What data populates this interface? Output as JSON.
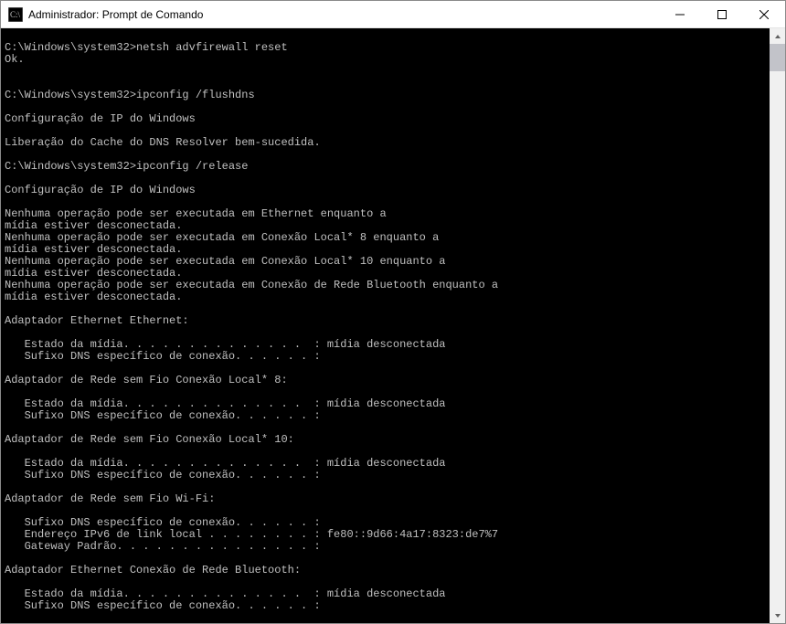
{
  "window": {
    "title": "Administrador: Prompt de Comando"
  },
  "terminal": {
    "lines": [
      "",
      "C:\\Windows\\system32>netsh advfirewall reset",
      "Ok.",
      "",
      "",
      "C:\\Windows\\system32>ipconfig /flushdns",
      "",
      "Configuração de IP do Windows",
      "",
      "Liberação do Cache do DNS Resolver bem-sucedida.",
      "",
      "C:\\Windows\\system32>ipconfig /release",
      "",
      "Configuração de IP do Windows",
      "",
      "Nenhuma operação pode ser executada em Ethernet enquanto a",
      "mídia estiver desconectada.",
      "Nenhuma operação pode ser executada em Conexão Local* 8 enquanto a",
      "mídia estiver desconectada.",
      "Nenhuma operação pode ser executada em Conexão Local* 10 enquanto a",
      "mídia estiver desconectada.",
      "Nenhuma operação pode ser executada em Conexão de Rede Bluetooth enquanto a",
      "mídia estiver desconectada.",
      "",
      "Adaptador Ethernet Ethernet:",
      "",
      "   Estado da mídia. . . . . . . . . . . . . .  : mídia desconectada",
      "   Sufixo DNS específico de conexão. . . . . . :",
      "",
      "Adaptador de Rede sem Fio Conexão Local* 8:",
      "",
      "   Estado da mídia. . . . . . . . . . . . . .  : mídia desconectada",
      "   Sufixo DNS específico de conexão. . . . . . :",
      "",
      "Adaptador de Rede sem Fio Conexão Local* 10:",
      "",
      "   Estado da mídia. . . . . . . . . . . . . .  : mídia desconectada",
      "   Sufixo DNS específico de conexão. . . . . . :",
      "",
      "Adaptador de Rede sem Fio Wi-Fi:",
      "",
      "   Sufixo DNS específico de conexão. . . . . . :",
      "   Endereço IPv6 de link local . . . . . . . . : fe80::9d66:4a17:8323:de7%7",
      "   Gateway Padrão. . . . . . . . . . . . . . . :",
      "",
      "Adaptador Ethernet Conexão de Rede Bluetooth:",
      "",
      "   Estado da mídia. . . . . . . . . . . . . .  : mídia desconectada",
      "   Sufixo DNS específico de conexão. . . . . . :"
    ]
  }
}
